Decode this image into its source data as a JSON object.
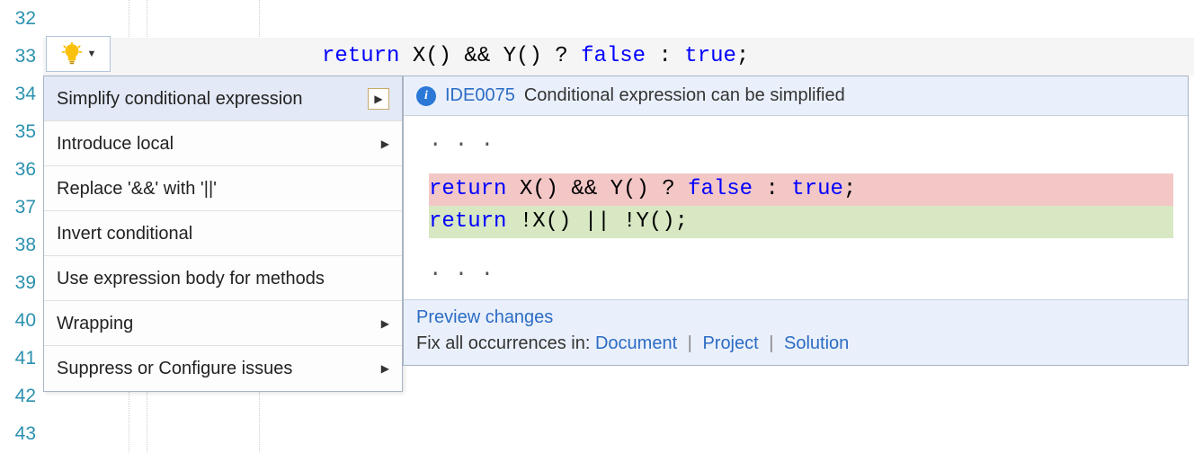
{
  "gutter": {
    "start": 32,
    "end": 43
  },
  "code": {
    "tokens": [
      {
        "t": "return",
        "c": "kw"
      },
      {
        "t": " X() && Y() ? ",
        "c": ""
      },
      {
        "t": "false",
        "c": "blu"
      },
      {
        "t": " : ",
        "c": ""
      },
      {
        "t": "true",
        "c": "blu"
      },
      {
        "t": ";",
        "c": ""
      }
    ]
  },
  "menu": {
    "items": [
      {
        "label": "Simplify conditional expression",
        "submenu": true,
        "selected": true,
        "boxed": true
      },
      {
        "label": "Introduce local",
        "submenu": true
      },
      {
        "label": "Replace '&&' with '||'",
        "submenu": false
      },
      {
        "label": "Invert conditional",
        "submenu": false
      },
      {
        "label": "Use expression body for methods",
        "submenu": false
      },
      {
        "label": "Wrapping",
        "submenu": true
      },
      {
        "label": "Suppress or Configure issues",
        "submenu": true
      }
    ]
  },
  "preview": {
    "diag_code": "IDE0075",
    "diag_msg": "Conditional expression can be simplified",
    "ellipsis": ". . .",
    "old_tokens": [
      {
        "t": "return",
        "c": "kw"
      },
      {
        "t": " X() && Y() ? ",
        "c": ""
      },
      {
        "t": "false",
        "c": "blu"
      },
      {
        "t": " : ",
        "c": ""
      },
      {
        "t": "true",
        "c": "blu"
      },
      {
        "t": ";",
        "c": ""
      }
    ],
    "new_tokens": [
      {
        "t": "return",
        "c": "kw"
      },
      {
        "t": " !X() || !Y();",
        "c": ""
      }
    ],
    "preview_link": "Preview changes",
    "fix_label": "Fix all occurrences in: ",
    "fix_links": [
      "Document",
      "Project",
      "Solution"
    ],
    "sep": " | "
  }
}
